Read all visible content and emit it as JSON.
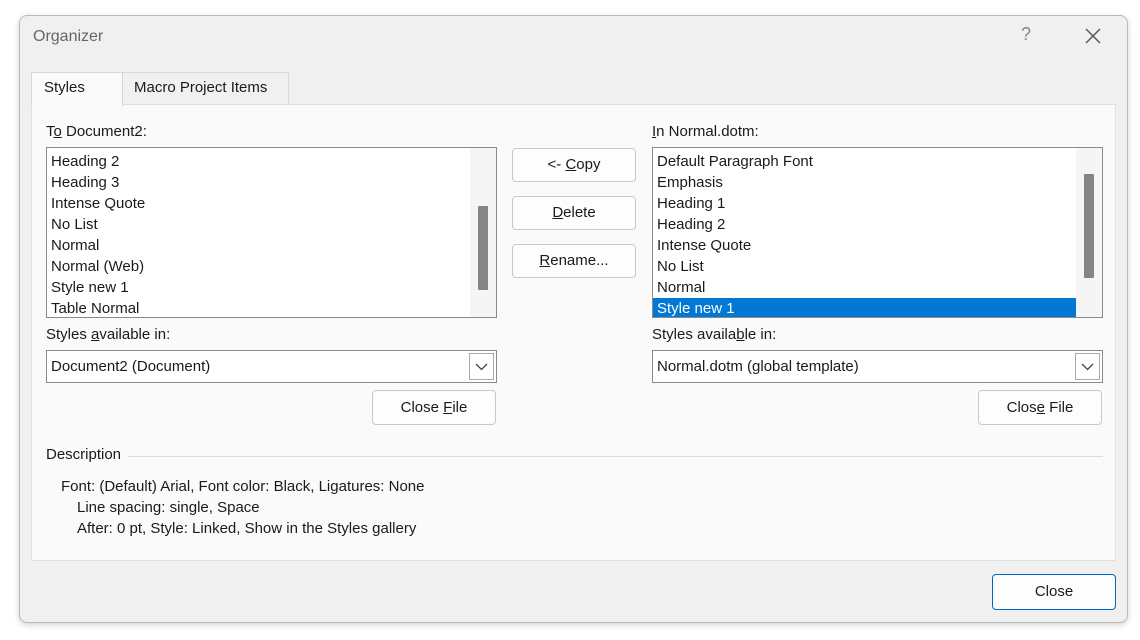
{
  "dialog": {
    "title": "Organizer",
    "help_glyph": "?"
  },
  "tabs": [
    {
      "label": "Styles",
      "active": true
    },
    {
      "label": "Macro Project Items",
      "active": false
    }
  ],
  "left": {
    "label_pre": "T",
    "label_u": "o",
    "label_post": " Document2:",
    "items": [
      "Heading 2",
      "Heading 3",
      "Intense Quote",
      "No List",
      "Normal",
      "Normal (Web)",
      "Style new 1",
      "Table Normal"
    ],
    "available_pre": "Styles ",
    "available_u": "a",
    "available_post": "vailable in:",
    "combo_value": "Document2 (Document)",
    "close_file_pre": "Close ",
    "close_file_u": "F",
    "close_file_post": "ile"
  },
  "right": {
    "label_pre": "",
    "label_u": "I",
    "label_post": "n Normal.dotm:",
    "items": [
      "Default Paragraph Font",
      "Emphasis",
      "Heading 1",
      "Heading 2",
      "Intense Quote",
      "No List",
      "Normal",
      "Style new 1"
    ],
    "selected_item": "Style new 1",
    "available_pre": "Styles availa",
    "available_u": "b",
    "available_post": "le in:",
    "combo_value": "Normal.dotm (global template)",
    "close_file_pre": "Clos",
    "close_file_u": "e",
    "close_file_post": " File"
  },
  "middle_buttons": {
    "copy_pre": "<- ",
    "copy_u": "C",
    "copy_post": "opy",
    "delete_u": "D",
    "delete_post": "elete",
    "rename_u": "R",
    "rename_post": "ename..."
  },
  "description": {
    "heading": "Description",
    "line1": "Font: (Default) Arial, Font color: Black, Ligatures: None",
    "line2": "Line spacing:  single, Space",
    "line3": "After:  0 pt, Style: Linked, Show in the Styles gallery"
  },
  "footer": {
    "close_label": "Close"
  },
  "colors": {
    "selection": "#0078d4",
    "primary_border": "#0067c0"
  }
}
